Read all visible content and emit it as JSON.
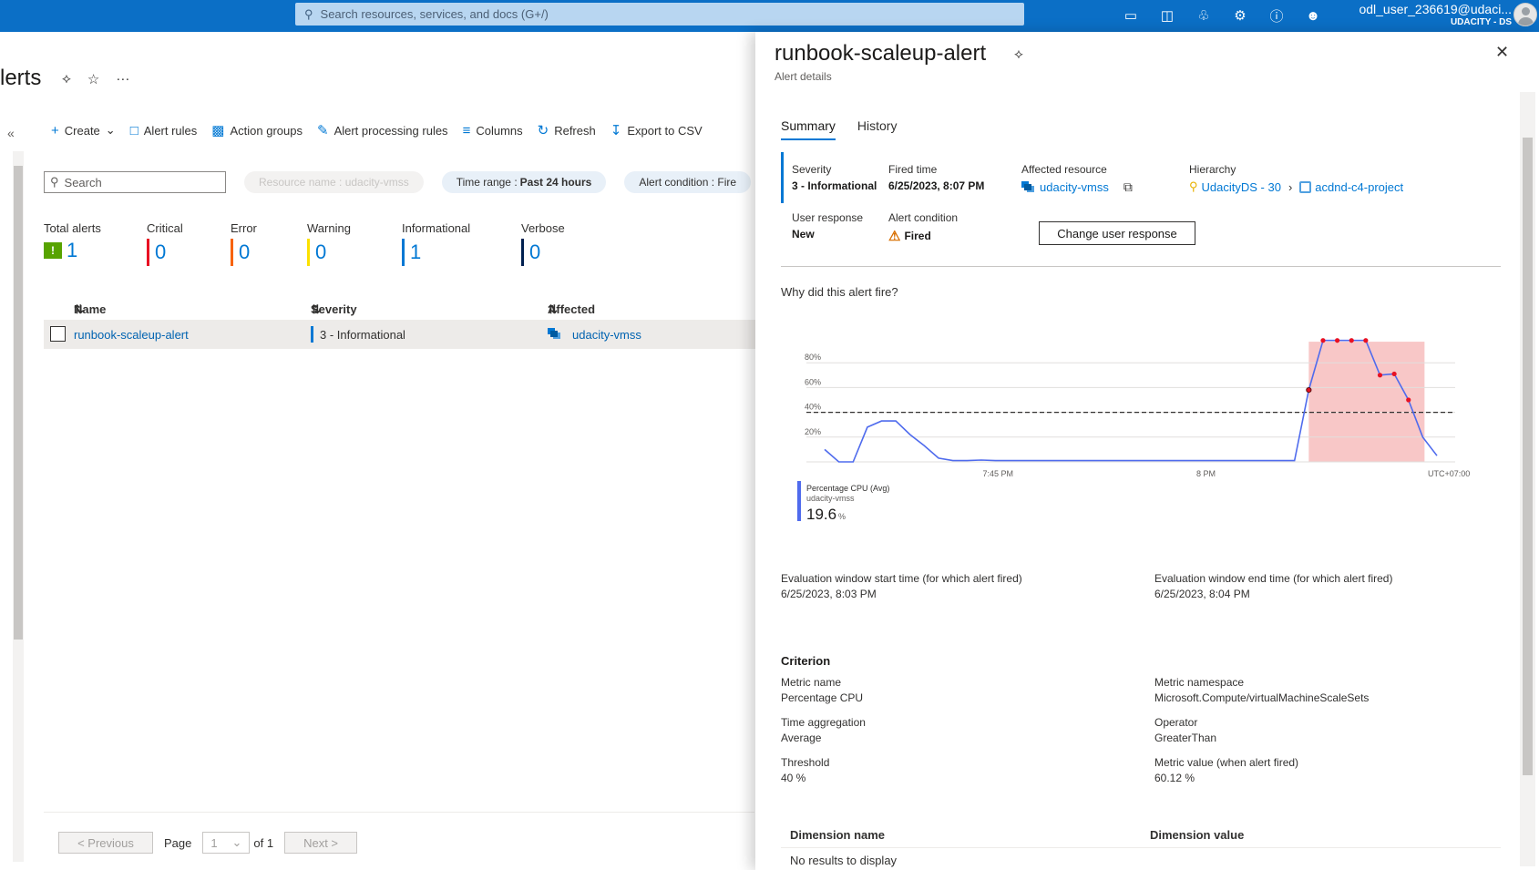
{
  "topbar": {
    "search_placeholder": "Search resources, services, and docs (G+/)",
    "icons": [
      "cloud-shell-icon",
      "directory-filter-icon",
      "notifications-icon",
      "settings-icon",
      "help-icon",
      "feedback-icon"
    ],
    "user_name": "odl_user_236619@udaci...",
    "user_org": "UDACITY - DS"
  },
  "page": {
    "title": "lerts",
    "toolbar": [
      {
        "label": "Create",
        "icon": "plus-icon"
      },
      {
        "label": "Alert rules",
        "icon": "alert-rules-icon"
      },
      {
        "label": "Action groups",
        "icon": "action-groups-icon"
      },
      {
        "label": "Alert processing rules",
        "icon": "alert-processing-icon"
      },
      {
        "label": "Columns",
        "icon": "columns-icon"
      },
      {
        "label": "Refresh",
        "icon": "refresh-icon"
      },
      {
        "label": "Export to CSV",
        "icon": "download-icon"
      }
    ],
    "search_placeholder": "Search",
    "filters": {
      "resource_name": "Resource name : udacity-vmss",
      "time_range_key": "Time range :",
      "time_range_val": "Past 24 hours",
      "alert_condition": "Alert condition : Fire"
    },
    "counts": [
      {
        "label": "Total alerts",
        "value": "1",
        "color": "#57a300"
      },
      {
        "label": "Critical",
        "value": "0",
        "color": "#e81123"
      },
      {
        "label": "Error",
        "value": "0",
        "color": "#f7630c"
      },
      {
        "label": "Warning",
        "value": "0",
        "color": "#fce100"
      },
      {
        "label": "Informational",
        "value": "1",
        "color": "#0078d4"
      },
      {
        "label": "Verbose",
        "value": "0",
        "color": "#002050"
      }
    ],
    "table": {
      "headers": [
        "Name",
        "Severity",
        "Affected resource"
      ],
      "rows": [
        {
          "name": "runbook-scaleup-alert",
          "severity": "3 - Informational",
          "resource": "udacity-vmss"
        }
      ]
    },
    "pagination": {
      "previous": "< Previous",
      "page_label": "Page",
      "page_value": "1",
      "of_label": "of 1",
      "next": "Next >"
    }
  },
  "panel": {
    "title": "runbook-scaleup-alert",
    "subtitle": "Alert details",
    "tabs": [
      "Summary",
      "History"
    ],
    "summary": {
      "severity_label": "Severity",
      "severity_value": "3 - Informational",
      "fired_label": "Fired time",
      "fired_value": "6/25/2023, 8:07 PM",
      "resource_label": "Affected resource",
      "resource_value": "udacity-vmss",
      "hierarchy_label": "Hierarchy",
      "hierarchy_1": "UdacityDS - 30",
      "hierarchy_2": "acdnd-c4-project",
      "user_response_label": "User response",
      "user_response_value": "New",
      "condition_label": "Alert condition",
      "condition_value": "Fired",
      "change_button": "Change user response"
    },
    "why_label": "Why did this alert fire?",
    "eval_start_label": "Evaluation window start time (for which alert fired)",
    "eval_start_value": "6/25/2023, 8:03 PM",
    "eval_end_label": "Evaluation window end time (for which alert fired)",
    "eval_end_value": "6/25/2023, 8:04 PM",
    "criterion": {
      "title": "Criterion",
      "metric_name_label": "Metric name",
      "metric_name_value": "Percentage CPU",
      "namespace_label": "Metric namespace",
      "namespace_value": "Microsoft.Compute/virtualMachineScaleSets",
      "aggregation_label": "Time aggregation",
      "aggregation_value": "Average",
      "operator_label": "Operator",
      "operator_value": "GreaterThan",
      "threshold_label": "Threshold",
      "threshold_value": "40 %",
      "metric_value_label": "Metric value (when alert fired)",
      "metric_value_value": "60.12 %"
    },
    "dimension": {
      "col1": "Dimension name",
      "col2": "Dimension value",
      "empty": "No results to display"
    }
  },
  "chart_data": {
    "type": "line",
    "y_ticks": [
      "20%",
      "40%",
      "60%",
      "80%"
    ],
    "x_ticks": [
      "7:45 PM",
      "8 PM"
    ],
    "timezone_label": "UTC+07:00",
    "ylim": [
      0,
      100
    ],
    "threshold": 40,
    "series": [
      {
        "name": "Percentage CPU (Avg)",
        "values": [
          10,
          0,
          0,
          28,
          33,
          33,
          22,
          13,
          3,
          1,
          1,
          1.5,
          1,
          1,
          1,
          1,
          1,
          1,
          1,
          1,
          1,
          1,
          1,
          1,
          1,
          1,
          1,
          1,
          1,
          1,
          1,
          1,
          1,
          1,
          58,
          98,
          98,
          98,
          98,
          70,
          71,
          50,
          20,
          5
        ]
      }
    ],
    "legend": {
      "metric": "Percentage CPU (Avg)",
      "resource": "udacity-vmss",
      "value": "19.6",
      "unit": "%"
    },
    "line_color": "#4f6bed",
    "alert_region_color": "#f8c7c7"
  }
}
